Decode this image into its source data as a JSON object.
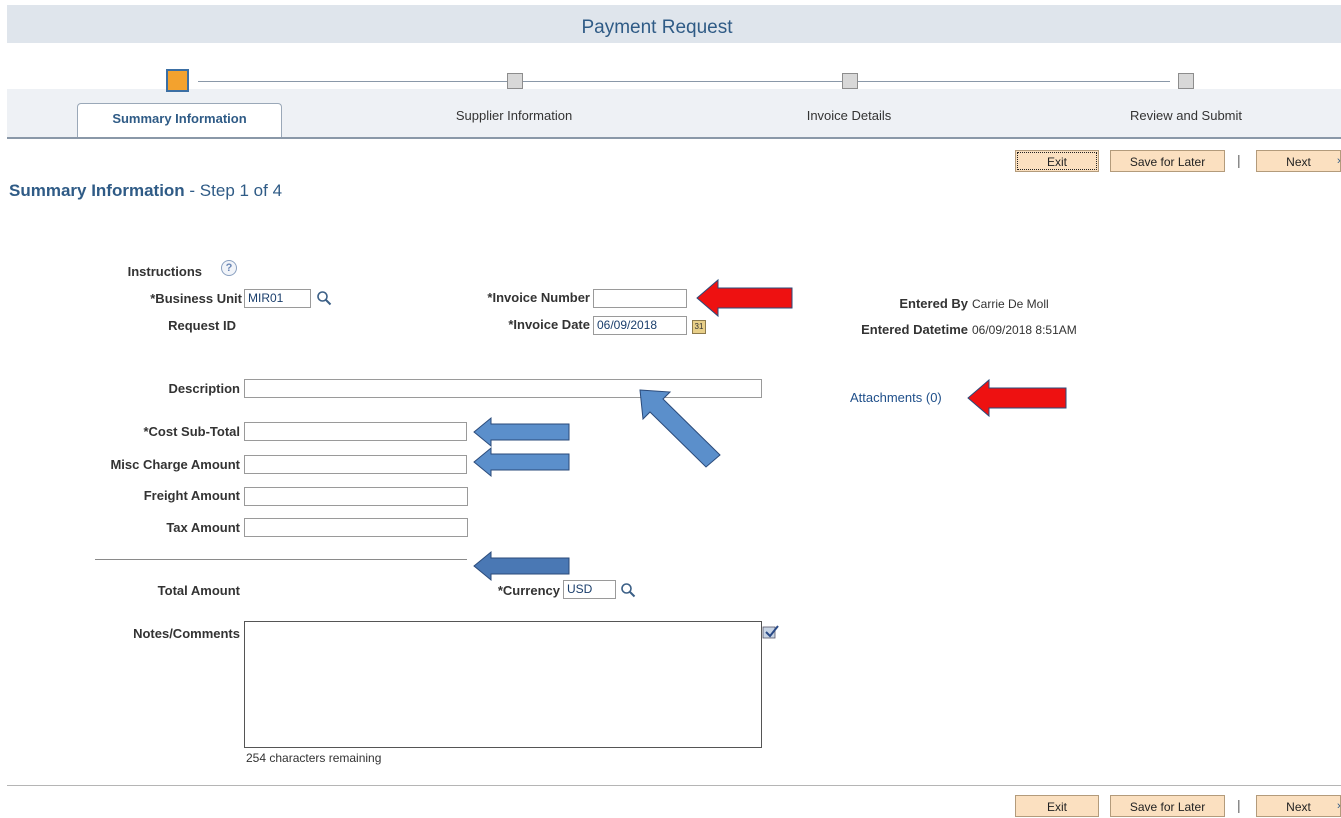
{
  "header": {
    "title": "Payment Request"
  },
  "train": {
    "steps": [
      {
        "label": "Summary Information",
        "active": true
      },
      {
        "label": "Supplier Information",
        "active": false
      },
      {
        "label": "Invoice Details",
        "active": false
      },
      {
        "label": "Review and Submit",
        "active": false
      }
    ]
  },
  "toolbar": {
    "exit_label": "Exit",
    "save_label": "Save for Later",
    "separator": "|",
    "next_label": "Next",
    "next_arrow": "›"
  },
  "page": {
    "title": "Summary Information",
    "step_text": " - Step 1 of 4"
  },
  "form": {
    "instructions_label": "Instructions",
    "help_glyph": "?",
    "business_unit_label": "*Business Unit",
    "business_unit_value": "MIR01",
    "request_id_label": "Request ID",
    "invoice_number_label": "*Invoice Number",
    "invoice_number_value": "",
    "invoice_date_label": "*Invoice Date",
    "invoice_date_value": "06/09/2018",
    "calendar_glyph": "31",
    "entered_by_label": "Entered By",
    "entered_by_value": "Carrie De Moll",
    "entered_datetime_label": "Entered Datetime",
    "entered_datetime_value": "06/09/2018  8:51AM",
    "description_label": "Description",
    "description_value": "",
    "attachments_link": "Attachments (0)",
    "cost_subtotal_label": "*Cost Sub-Total",
    "misc_charge_label": "Misc Charge Amount",
    "freight_label": "Freight Amount",
    "tax_label": "Tax Amount",
    "total_label": "Total Amount",
    "currency_label": "*Currency",
    "currency_value": "USD",
    "notes_label": "Notes/Comments",
    "notes_value": "",
    "chars_remaining": "254 characters remaining"
  },
  "annotations": {
    "red_arrow_color": "#ee1111",
    "blue_arrow_color": "#5b8fcb"
  }
}
